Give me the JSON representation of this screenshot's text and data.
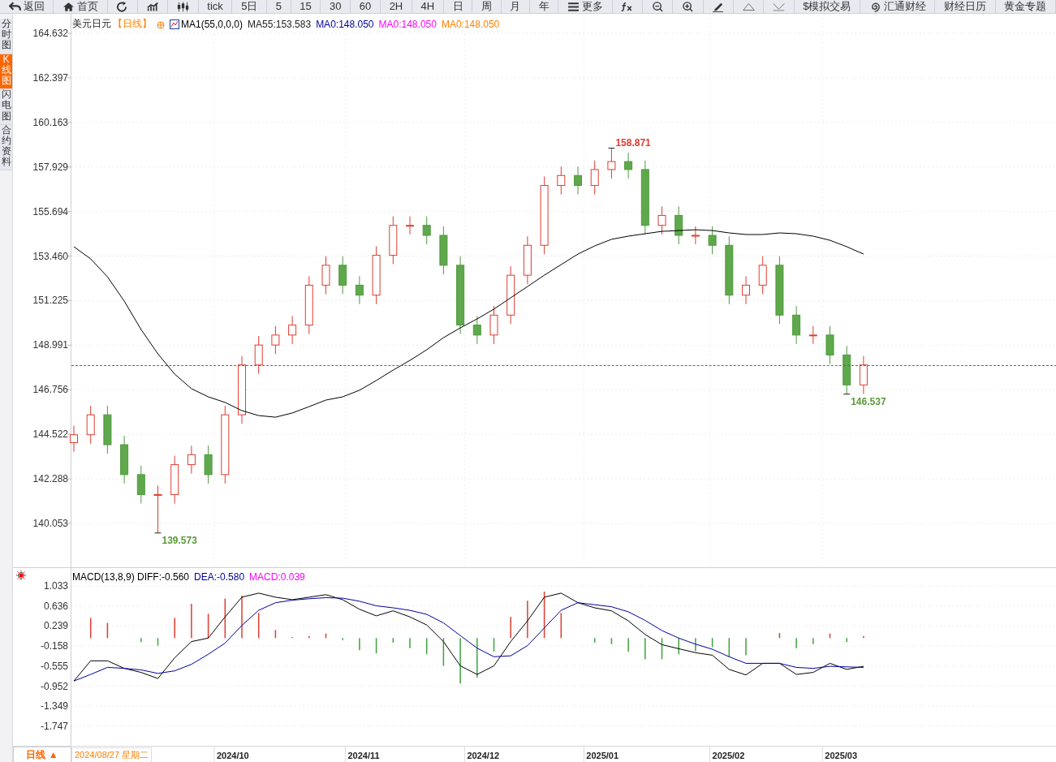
{
  "toolbar": [
    {
      "kind": "back",
      "label": "返回"
    },
    {
      "kind": "home",
      "label": "首页"
    },
    {
      "kind": "refresh"
    },
    {
      "kind": "bars"
    },
    {
      "kind": "candles"
    },
    {
      "kind": "text",
      "label": "tick"
    },
    {
      "kind": "text",
      "label": "5日"
    },
    {
      "kind": "text",
      "label": "5"
    },
    {
      "kind": "text",
      "label": "15"
    },
    {
      "kind": "text",
      "label": "30"
    },
    {
      "kind": "text",
      "label": "60"
    },
    {
      "kind": "text",
      "label": "2H"
    },
    {
      "kind": "text",
      "label": "4H"
    },
    {
      "kind": "text",
      "label": "日"
    },
    {
      "kind": "text",
      "label": "周"
    },
    {
      "kind": "text",
      "label": "月"
    },
    {
      "kind": "text",
      "label": "年"
    },
    {
      "kind": "menu",
      "label": "更多"
    },
    {
      "kind": "fx"
    },
    {
      "kind": "zoom-out"
    },
    {
      "kind": "zoom-in"
    },
    {
      "kind": "pen"
    },
    {
      "kind": "triangle"
    },
    {
      "kind": "triangle-line"
    },
    {
      "kind": "text",
      "label": "$模拟交易"
    },
    {
      "kind": "swirl",
      "label": "汇通财经"
    },
    {
      "kind": "text",
      "label": "财经日历"
    },
    {
      "kind": "text",
      "label": "黄金专题"
    }
  ],
  "sidebar": {
    "tabs": [
      {
        "label": "分时图",
        "selected": false
      },
      {
        "label": "K线图",
        "selected": true
      },
      {
        "label": "闪电图",
        "selected": false
      },
      {
        "label": "合约资料",
        "selected": false
      }
    ]
  },
  "price_chart": {
    "symbol": "美元日元",
    "period": "【日线】",
    "ma_reading": ":153.583",
    "legend": [
      {
        "text": "MA1(55,0,0,0)",
        "color": "#000000"
      },
      {
        "text": "MA0:148.050",
        "color": "#0000a0"
      },
      {
        "text": "MA0:148.050",
        "color": "#ff00ff"
      },
      {
        "text": "MA0:148.050",
        "color": "#ff8000"
      }
    ],
    "chart_data": {
      "type": "candlestick",
      "grid": true,
      "ylim": [
        137.855,
        165.61
      ],
      "yticks": [
        {
          "value": 164.632,
          "label": "164.632"
        },
        {
          "value": 162.397,
          "label": "162.397"
        },
        {
          "value": 160.163,
          "label": "160.163"
        },
        {
          "value": 157.929,
          "label": "157.929"
        },
        {
          "value": 155.694,
          "label": "155.694"
        },
        {
          "value": 153.46,
          "label": "153.460"
        },
        {
          "value": 151.225,
          "label": "151.225"
        },
        {
          "value": 148.991,
          "label": "148.991"
        },
        {
          "value": 146.756,
          "label": "146.756"
        },
        {
          "value": 144.522,
          "label": "144.522"
        },
        {
          "value": 142.288,
          "label": "142.288"
        },
        {
          "value": 140.053,
          "label": "140.053"
        }
      ],
      "ohlc": [
        [
          144.1,
          144.95,
          143.65,
          144.5
        ],
        [
          144.5,
          145.95,
          144.05,
          145.5
        ],
        [
          145.5,
          145.95,
          143.55,
          144
        ],
        [
          144,
          144.45,
          142.05,
          142.5
        ],
        [
          142.5,
          142.95,
          141.05,
          141.5
        ],
        [
          141.5,
          141.95,
          139.573,
          141.5
        ],
        [
          141.5,
          143.45,
          141.05,
          143
        ],
        [
          143,
          143.95,
          142.55,
          143.5
        ],
        [
          143.5,
          143.95,
          142.05,
          142.5
        ],
        [
          142.5,
          145.95,
          142.05,
          145.5
        ],
        [
          145.5,
          148.45,
          145.05,
          148
        ],
        [
          148,
          149.45,
          147.55,
          149
        ],
        [
          149,
          149.95,
          148.55,
          149.5
        ],
        [
          149.5,
          150.45,
          149.05,
          150
        ],
        [
          150,
          152.45,
          149.55,
          152
        ],
        [
          152,
          153.45,
          151.55,
          153
        ],
        [
          153,
          153.45,
          151.55,
          152
        ],
        [
          152,
          152.45,
          151.05,
          151.5
        ],
        [
          151.5,
          153.95,
          151.05,
          153.5
        ],
        [
          153.5,
          155.45,
          153.05,
          155
        ],
        [
          155,
          155.45,
          154.55,
          155
        ],
        [
          155,
          155.45,
          154.05,
          154.5
        ],
        [
          154.5,
          154.95,
          152.55,
          153
        ],
        [
          153,
          153.45,
          149.55,
          150
        ],
        [
          150,
          150.45,
          149.05,
          149.5
        ],
        [
          149.5,
          150.95,
          149.05,
          150.5
        ],
        [
          150.5,
          152.95,
          150.05,
          152.5
        ],
        [
          152.5,
          154.45,
          152.05,
          154
        ],
        [
          154,
          157.45,
          153.55,
          157
        ],
        [
          157,
          157.95,
          156.55,
          157.5
        ],
        [
          157.5,
          157.95,
          156.55,
          157
        ],
        [
          157,
          158.25,
          156.55,
          157.8
        ],
        [
          157.8,
          158.871,
          157.35,
          158.2
        ],
        [
          158.2,
          158.65,
          157.35,
          157.8
        ],
        [
          157.8,
          158.25,
          154.55,
          155
        ],
        [
          155,
          155.95,
          154.55,
          155.5
        ],
        [
          155.5,
          155.95,
          154.05,
          154.5
        ],
        [
          154.5,
          154.95,
          154.05,
          154.5
        ],
        [
          154.5,
          154.95,
          153.55,
          154
        ],
        [
          154,
          154.45,
          151.05,
          151.5
        ],
        [
          151.5,
          152.45,
          151.05,
          152
        ],
        [
          152,
          153.45,
          151.55,
          153
        ],
        [
          153,
          153.45,
          150.05,
          150.5
        ],
        [
          150.5,
          150.95,
          149.05,
          149.5
        ],
        [
          149.5,
          149.95,
          149.05,
          149.5
        ],
        [
          149.5,
          149.95,
          148.05,
          148.5
        ],
        [
          148.5,
          148.95,
          146.537,
          147
        ],
        [
          147,
          148.45,
          146.55,
          148
        ]
      ],
      "series": [
        {
          "name": "MA55",
          "type": "line",
          "color": "#000000",
          "values": [
            153.93,
            153.32,
            152.42,
            151.2,
            149.78,
            148.56,
            147.54,
            146.81,
            146.4,
            146.12,
            145.71,
            145.46,
            145.38,
            145.59,
            145.91,
            146.24,
            146.4,
            146.73,
            147.22,
            147.74,
            148.23,
            148.76,
            149.37,
            149.86,
            150.31,
            150.8,
            151.37,
            151.93,
            152.5,
            153.03,
            153.56,
            153.97,
            154.3,
            154.46,
            154.58,
            154.7,
            154.74,
            154.78,
            154.74,
            154.62,
            154.54,
            154.54,
            154.62,
            154.58,
            154.46,
            154.25,
            153.93,
            153.56
          ]
        }
      ],
      "annotations": [
        "158.871",
        "146.537",
        "139.573"
      ]
    }
  },
  "macd_chart": {
    "header": [
      {
        "text": "MACD(13,8,9) DIFF:-0.560",
        "color": "#000000"
      },
      {
        "text": "DEA:-0.580",
        "color": "#0000a0"
      },
      {
        "text": "MACD:0.039",
        "color": "#ff00ff"
      }
    ],
    "chart_data": {
      "type": "bar",
      "grid": true,
      "ylim": [
        -2.133,
        1.403
      ],
      "yticks": [
        {
          "value": 1.033,
          "label": "1.033"
        },
        {
          "value": 0.636,
          "label": "0.636"
        },
        {
          "value": 0.239,
          "label": "0.239"
        },
        {
          "value": -0.158,
          "label": "-0.158"
        },
        {
          "value": -0.555,
          "label": "-0.555"
        },
        {
          "value": -0.952,
          "label": "-0.952"
        },
        {
          "value": -1.349,
          "label": "-1.349"
        },
        {
          "value": -1.747,
          "label": "-1.747"
        }
      ],
      "series": [
        {
          "type": "bar",
          "colors": [
            "#e03c31",
            "#e03c31",
            "#e03c31",
            "#e03c31",
            "#3ea23e",
            "#3ea23e",
            "#e03c31",
            "#e03c31",
            "#e03c31",
            "#e03c31",
            "#e03c31",
            "#e03c31",
            "#e03c31",
            "#e03c31",
            "#e03c31",
            "#e03c31",
            "#3ea23e",
            "#3ea23e",
            "#3ea23e",
            "#3ea23e",
            "#3ea23e",
            "#3ea23e",
            "#3ea23e",
            "#3ea23e",
            "#3ea23e",
            "#3ea23e",
            "#e03c31",
            "#e03c31",
            "#e03c31",
            "#e03c31",
            "#e03c31",
            "#3ea23e",
            "#3ea23e",
            "#3ea23e",
            "#3ea23e",
            "#3ea23e",
            "#3ea23e",
            "#3ea23e",
            "#3ea23e",
            "#3ea23e",
            "#3ea23e",
            "#e03c31",
            "#e03c31",
            "#3ea23e",
            "#3ea23e",
            "#e03c31",
            "#3ea23e",
            "#e03c31"
          ],
          "values": [
            0,
            0.4,
            0.3,
            0,
            -0.08,
            -0.15,
            0.4,
            0.68,
            0.48,
            0.78,
            0.84,
            0.5,
            0.16,
            0.02,
            0.04,
            0.09,
            -0.04,
            -0.24,
            -0.3,
            -0.09,
            -0.2,
            -0.32,
            -0.55,
            -0.9,
            -0.78,
            -0.27,
            0.42,
            0.74,
            0.92,
            0.5,
            0,
            -0.09,
            -0.12,
            -0.27,
            -0.42,
            -0.42,
            -0.32,
            -0.26,
            -0.18,
            -0.38,
            -0.34,
            0,
            0.1,
            -0.2,
            -0.12,
            0.09,
            -0.08,
            0.04
          ]
        },
        {
          "type": "line",
          "color": "#000000",
          "values": [
            -0.85,
            -0.45,
            -0.45,
            -0.6,
            -0.68,
            -0.8,
            -0.39,
            -0.07,
            0,
            0.42,
            0.81,
            0.89,
            0.81,
            0.76,
            0.81,
            0.86,
            0.76,
            0.57,
            0.44,
            0.54,
            0.42,
            0.26,
            -0.07,
            -0.55,
            -0.72,
            -0.55,
            -0.07,
            0.34,
            0.81,
            0.89,
            0.7,
            0.6,
            0.54,
            0.34,
            0.07,
            -0.13,
            -0.21,
            -0.29,
            -0.34,
            -0.62,
            -0.73,
            -0.5,
            -0.5,
            -0.72,
            -0.68,
            -0.5,
            -0.62,
            -0.56
          ]
        },
        {
          "type": "line",
          "color": "#0000a0",
          "values": [
            -0.85,
            -0.72,
            -0.58,
            -0.6,
            -0.63,
            -0.7,
            -0.65,
            -0.52,
            -0.32,
            -0.1,
            0.25,
            0.55,
            0.7,
            0.75,
            0.78,
            0.8,
            0.79,
            0.73,
            0.64,
            0.6,
            0.55,
            0.47,
            0.3,
            0.05,
            -0.2,
            -0.37,
            -0.35,
            -0.15,
            0.2,
            0.55,
            0.7,
            0.66,
            0.62,
            0.52,
            0.35,
            0.15,
            0,
            -0.12,
            -0.22,
            -0.37,
            -0.5,
            -0.5,
            -0.5,
            -0.58,
            -0.6,
            -0.56,
            -0.57,
            -0.58
          ]
        }
      ]
    }
  },
  "time_axis": {
    "period_button": "日线 ▲",
    "cursor_date": "2024/08/27 星期二",
    "labels": [
      "2024/10",
      "2024/11",
      "2024/12",
      "2025/01",
      "2025/02",
      "2025/03"
    ]
  }
}
